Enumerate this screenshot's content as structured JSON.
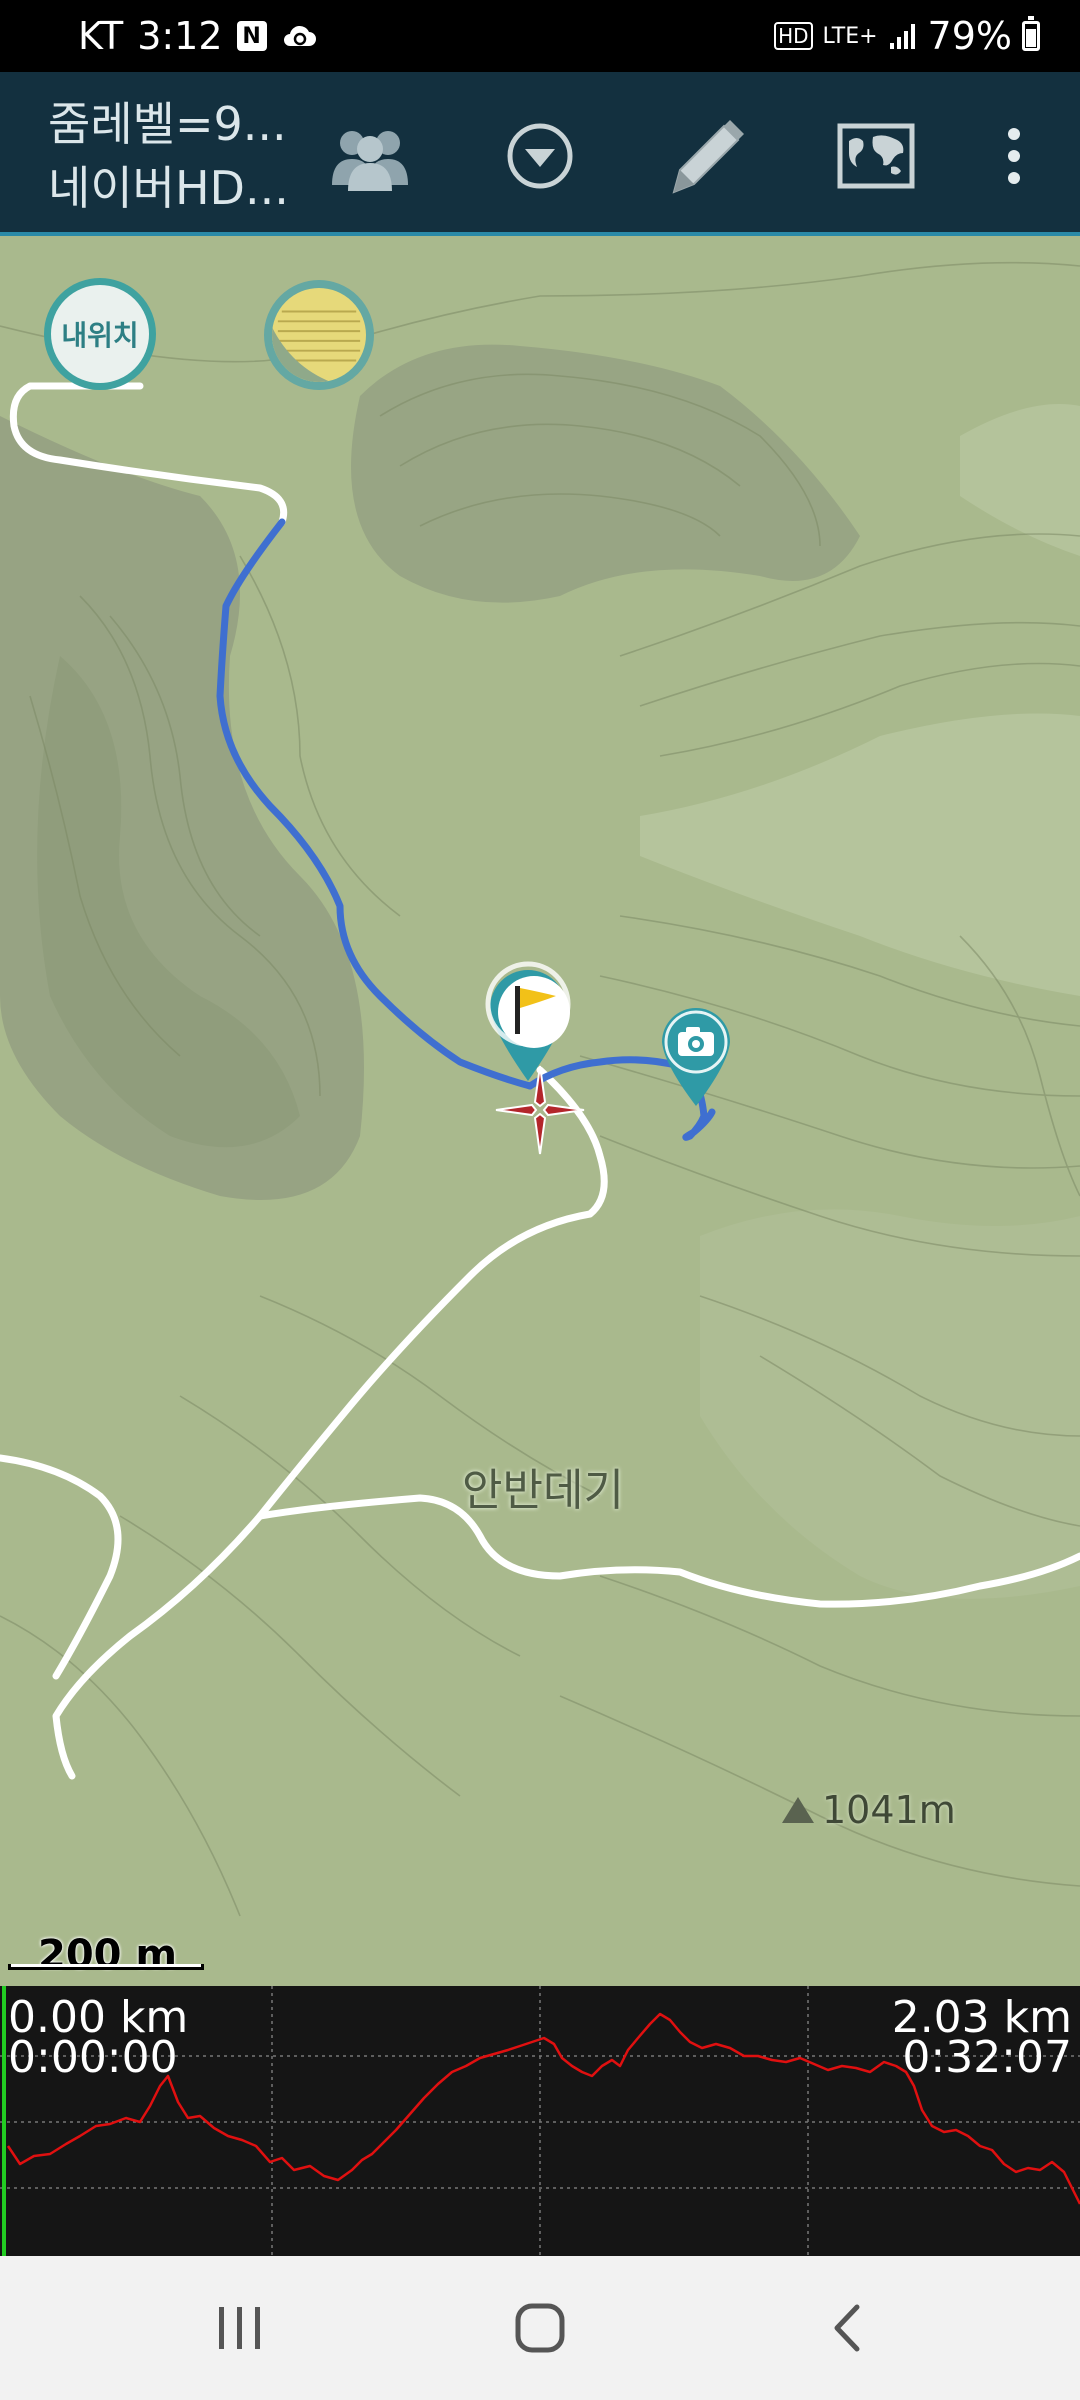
{
  "status_bar": {
    "carrier": "KT",
    "time": "3:12",
    "network_hd": "HD",
    "network_type": "LTE+",
    "battery_percent": "79%",
    "icons": [
      "naver-icon",
      "cloud-sync-icon",
      "hd-icon",
      "lte-icon",
      "signal-icon",
      "battery-icon"
    ]
  },
  "toolbar": {
    "title_line1": "줌레벨=9...",
    "title_line2": "네이버HD...",
    "buttons": [
      "group-icon",
      "dropdown-circle-icon",
      "pencil-icon",
      "world-map-icon",
      "more-vert-icon"
    ]
  },
  "map": {
    "my_location_label": "내위치",
    "place_name": "안반데기",
    "peak_label": "1041m",
    "scale_label": "200 m",
    "colors": {
      "track": "#3f6fd0",
      "trail": "#ffffff",
      "marker": "#2f9aa6",
      "crosshair": "#b3262b"
    },
    "markers": [
      "flag-marker-icon",
      "camera-marker-icon",
      "crosshair-icon"
    ]
  },
  "elevation_profile": {
    "start_distance": "0.00 km",
    "start_time": "0:00:00",
    "end_distance": "2.03 km",
    "end_time": "0:32:07",
    "line_color": "#e01010",
    "cursor_color": "#22cc22"
  },
  "nav_bar": {
    "buttons": [
      "recents-icon",
      "home-icon",
      "back-icon"
    ]
  }
}
